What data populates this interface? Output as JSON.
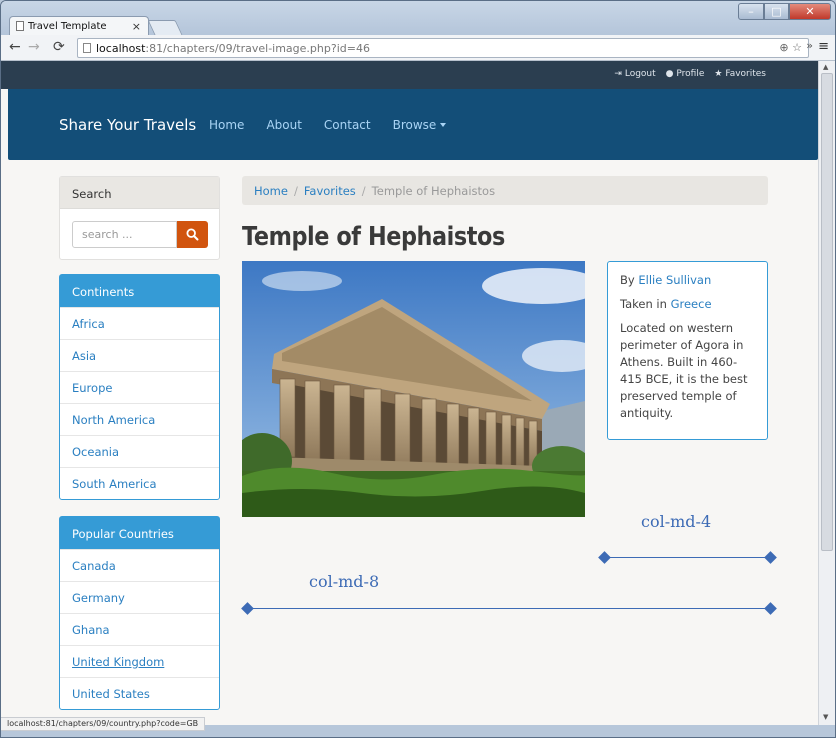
{
  "browser": {
    "tab_title": "Travel Template",
    "tab_close": "×",
    "url_host": "localhost",
    "url_rest": ":81/chapters/09/travel-image.php?id=46",
    "status_url": "localhost:81/chapters/09/country.php?code=GB",
    "icons": [
      "back-icon",
      "forward-icon",
      "reload-icon",
      "zoom-icon",
      "star-icon",
      "menu-icon"
    ]
  },
  "utility": {
    "logout": "Logout",
    "profile": "Profile",
    "favorites": "Favorites"
  },
  "navbar": {
    "brand": "Share Your Travels",
    "links": [
      "Home",
      "About",
      "Contact",
      "Browse"
    ]
  },
  "sidebar": {
    "search_title": "Search",
    "search_placeholder": "search ...",
    "continents_title": "Continents",
    "continents": [
      "Africa",
      "Asia",
      "Europe",
      "North America",
      "Oceania",
      "South America"
    ],
    "countries_title": "Popular Countries",
    "countries": [
      "Canada",
      "Germany",
      "Ghana",
      "United Kingdom",
      "United States"
    ]
  },
  "breadcrumb": {
    "home": "Home",
    "favorites": "Favorites",
    "current": "Temple of Hephaistos"
  },
  "main": {
    "title": "Temple of Hephaistos",
    "by_label": "By",
    "author": "Ellie Sullivan",
    "taken_label": "Taken in",
    "country": "Greece",
    "description": "Located on western perimeter of Agora in Athens. Built in 460-415 BCE, it is the best preserved temple of antiquity."
  },
  "annotations": {
    "col8": "col-md-8",
    "col4": "col-md-4",
    "accent_color": "#3d6bb5"
  },
  "colors": {
    "navbar": "#134e78",
    "utilbar": "#2b3e50",
    "panel_primary": "#359bd6",
    "search_button": "#d1540e",
    "link": "#2a7fc1"
  }
}
